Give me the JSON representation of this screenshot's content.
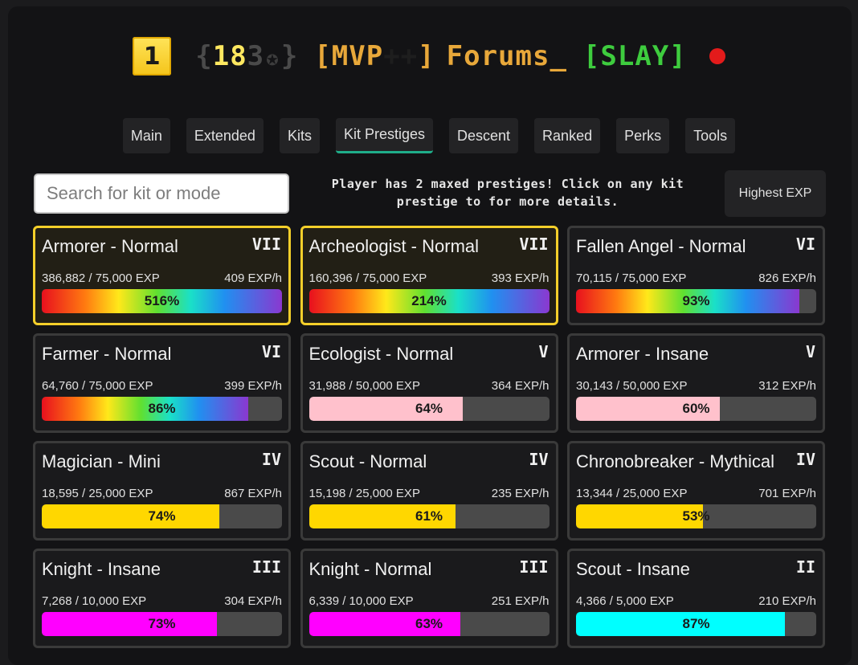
{
  "header": {
    "rank_number": "1",
    "level_open": "{",
    "level_digits_a": "18",
    "level_digits_b": "3",
    "level_icon": "✪",
    "level_close": "}",
    "mvp_open": "[MVP",
    "mvp_plus": "++",
    "mvp_close": "]",
    "player_name": "Forums_",
    "guild_tag": "[SLAY]",
    "status_color": "#e31b1b"
  },
  "tabs": [
    {
      "label": "Main",
      "active": false
    },
    {
      "label": "Extended",
      "active": false
    },
    {
      "label": "Kits",
      "active": false
    },
    {
      "label": "Kit Prestiges",
      "active": true
    },
    {
      "label": "Descent",
      "active": false
    },
    {
      "label": "Ranked",
      "active": false
    },
    {
      "label": "Perks",
      "active": false
    },
    {
      "label": "Tools",
      "active": false
    }
  ],
  "search": {
    "placeholder": "Search for kit or mode"
  },
  "notice": "Player has 2 maxed prestiges! Click on any kit prestige to for more details.",
  "sort_button": "Highest EXP",
  "colors": {
    "accent_tab": "#1fae8a",
    "maxed_border": "#f4cf2a",
    "pink": "#ffc1cc",
    "gold": "#ffd700",
    "magenta": "#ff00ff",
    "cyan": "#00ffff"
  },
  "kits": [
    {
      "title": "Armorer - Normal",
      "roman": "VII",
      "exp": "386,882 / 75,000 EXP",
      "rate": "409 EXP/h",
      "percent_label": "516%",
      "fill": 1.0,
      "style": "rainbow",
      "maxed": true
    },
    {
      "title": "Archeologist - Normal",
      "roman": "VII",
      "exp": "160,396 / 75,000 EXP",
      "rate": "393 EXP/h",
      "percent_label": "214%",
      "fill": 1.0,
      "style": "rainbow",
      "maxed": true
    },
    {
      "title": "Fallen Angel - Normal",
      "roman": "VI",
      "exp": "70,115 / 75,000 EXP",
      "rate": "826 EXP/h",
      "percent_label": "93%",
      "fill": 0.93,
      "style": "rainbow",
      "maxed": false
    },
    {
      "title": "Farmer - Normal",
      "roman": "VI",
      "exp": "64,760 / 75,000 EXP",
      "rate": "399 EXP/h",
      "percent_label": "86%",
      "fill": 0.86,
      "style": "rainbow",
      "maxed": false
    },
    {
      "title": "Ecologist - Normal",
      "roman": "V",
      "exp": "31,988 / 50,000 EXP",
      "rate": "364 EXP/h",
      "percent_label": "64%",
      "fill": 0.64,
      "style": "pink",
      "maxed": false
    },
    {
      "title": "Armorer - Insane",
      "roman": "V",
      "exp": "30,143 / 50,000 EXP",
      "rate": "312 EXP/h",
      "percent_label": "60%",
      "fill": 0.6,
      "style": "pink",
      "maxed": false
    },
    {
      "title": "Magician - Mini",
      "roman": "IV",
      "exp": "18,595 / 25,000 EXP",
      "rate": "867 EXP/h",
      "percent_label": "74%",
      "fill": 0.74,
      "style": "gold",
      "maxed": false
    },
    {
      "title": "Scout - Normal",
      "roman": "IV",
      "exp": "15,198 / 25,000 EXP",
      "rate": "235 EXP/h",
      "percent_label": "61%",
      "fill": 0.61,
      "style": "gold",
      "maxed": false
    },
    {
      "title": "Chronobreaker - Mythical",
      "roman": "IV",
      "exp": "13,344 / 25,000 EXP",
      "rate": "701 EXP/h",
      "percent_label": "53%",
      "fill": 0.53,
      "style": "gold",
      "maxed": false
    },
    {
      "title": "Knight - Insane",
      "roman": "III",
      "exp": "7,268 / 10,000 EXP",
      "rate": "304 EXP/h",
      "percent_label": "73%",
      "fill": 0.73,
      "style": "magenta",
      "maxed": false
    },
    {
      "title": "Knight - Normal",
      "roman": "III",
      "exp": "6,339 / 10,000 EXP",
      "rate": "251 EXP/h",
      "percent_label": "63%",
      "fill": 0.63,
      "style": "magenta",
      "maxed": false
    },
    {
      "title": "Scout - Insane",
      "roman": "II",
      "exp": "4,366 / 5,000 EXP",
      "rate": "210 EXP/h",
      "percent_label": "87%",
      "fill": 0.87,
      "style": "cyan",
      "maxed": false
    }
  ]
}
